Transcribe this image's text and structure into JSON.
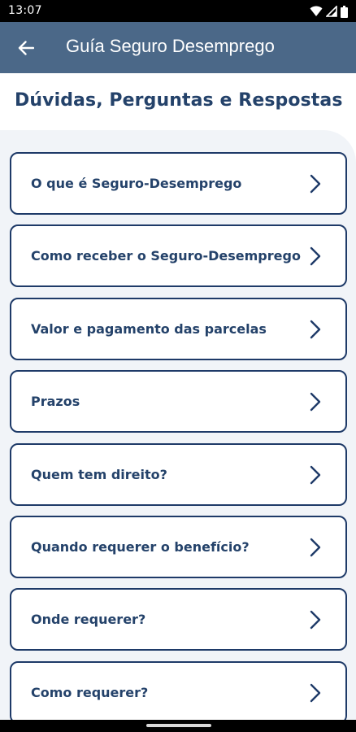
{
  "status_bar": {
    "time": "13:07",
    "icons": [
      "wifi-icon",
      "signal-icon",
      "battery-icon"
    ]
  },
  "app_bar": {
    "back_icon": "arrow-left-icon",
    "title": "Guía Seguro Desemprego"
  },
  "page": {
    "heading": "Dúvidas, Perguntas e Respostas"
  },
  "faq": {
    "chevron_icon": "chevron-right-icon",
    "items": [
      {
        "label": "O que é Seguro-Desemprego"
      },
      {
        "label": "Como receber o Seguro-Desemprego"
      },
      {
        "label": "Valor e pagamento das parcelas"
      },
      {
        "label": "Prazos"
      },
      {
        "label": "Quem tem direito?"
      },
      {
        "label": "Quando requerer o benefício?"
      },
      {
        "label": "Onde requerer?"
      },
      {
        "label": "Como requerer?"
      }
    ]
  },
  "colors": {
    "app_bar": "#4b6888",
    "heading_text": "#24426a",
    "card_border": "#1e3a68",
    "panel_background": "#f1f4f8"
  }
}
